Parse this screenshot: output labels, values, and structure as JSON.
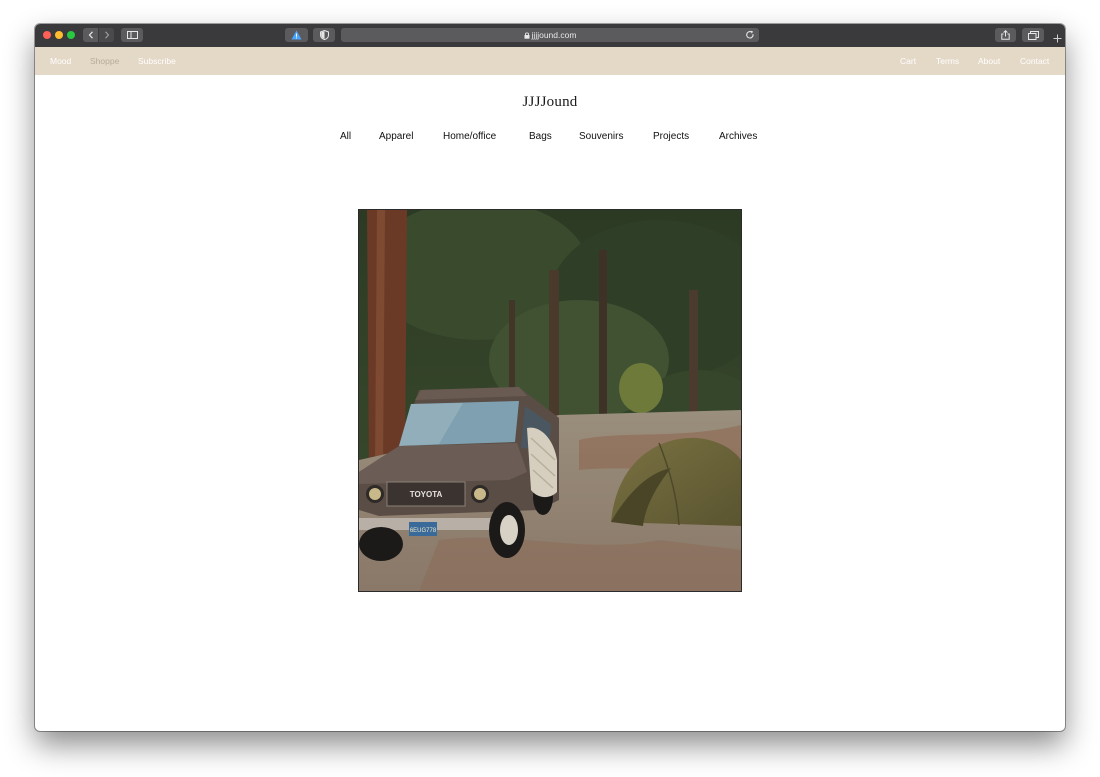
{
  "browser": {
    "url": "jjjjound.com"
  },
  "topbar": {
    "left_links": [
      "Mood",
      "Shoppe",
      "Subscribe"
    ],
    "right_links": [
      "Cart",
      "Terms",
      "About",
      "Contact"
    ]
  },
  "site": {
    "brand": "JJJJound"
  },
  "categories": [
    "All",
    "Apparel",
    "Home/office",
    "Bags",
    "Souvenirs",
    "Projects",
    "Archives"
  ],
  "hero": {
    "grille_text": "TOYOTA",
    "plate_text": "6EUG778"
  },
  "colors": {
    "topbar_bg": "#e4d8c7",
    "chrome_bg": "#3a3a3c"
  }
}
